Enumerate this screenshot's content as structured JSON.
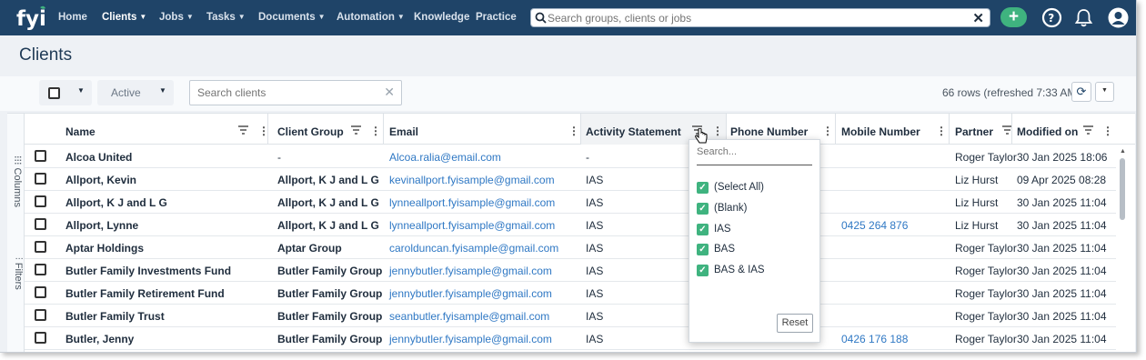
{
  "nav": {
    "items": [
      "Home",
      "Clients",
      "Jobs",
      "Tasks",
      "Documents",
      "Automation",
      "Knowledge",
      "Practice"
    ],
    "search_placeholder": "Search groups, clients or jobs",
    "add_label": "+"
  },
  "page": {
    "title": "Clients"
  },
  "toolbar": {
    "status_filter": "Active",
    "search_placeholder": "Search clients",
    "rows_info": "66 rows  (refreshed 7:33 AM)"
  },
  "side_panel": {
    "columns_label": "Columns",
    "filters_label": "Filters"
  },
  "columns": [
    "Name",
    "Client Group",
    "Email",
    "Activity Statement",
    "Phone Number",
    "Mobile Number",
    "Partner",
    "Modified on"
  ],
  "rows": [
    {
      "name": "Alcoa United",
      "group": "-",
      "email": "Alcoa.ralia@email.com",
      "activity": "-",
      "phone": "",
      "mobile": "",
      "partner": "Roger Taylor",
      "modified": "30 Jan 2025 18:06"
    },
    {
      "name": "Allport, Kevin",
      "group": "Allport, K J and L G",
      "email": "kevinallport.fyisample@gmail.com",
      "activity": "IAS",
      "phone": "",
      "mobile": "",
      "partner": "Liz Hurst",
      "modified": "09 Apr 2025 08:28"
    },
    {
      "name": "Allport, K J and L G",
      "group": "Allport, K J and L G",
      "email": "lynneallport.fyisample@gmail.com",
      "activity": "IAS",
      "phone": "",
      "mobile": "",
      "partner": "Liz Hurst",
      "modified": "30 Jan 2025 11:04"
    },
    {
      "name": "Allport, Lynne",
      "group": "Allport, K J and L G",
      "email": "lynneallport.fyisample@gmail.com",
      "activity": "IAS",
      "phone": "",
      "mobile": "0425 264 876",
      "partner": "Liz Hurst",
      "modified": "30 Jan 2025 11:04"
    },
    {
      "name": "Aptar Holdings",
      "group": "Aptar Group",
      "email": "carolduncan.fyisample@gmail.com",
      "activity": "IAS",
      "phone": "",
      "mobile": "",
      "partner": "Roger Taylor",
      "modified": "30 Jan 2025 11:04"
    },
    {
      "name": "Butler Family Investments Fund",
      "group": "Butler Family Group",
      "email": "jennybutler.fyisample@gmail.com",
      "activity": "IAS",
      "phone": "",
      "mobile": "",
      "partner": "Roger Taylor",
      "modified": "30 Jan 2025 11:04"
    },
    {
      "name": "Butler Family Retirement Fund",
      "group": "Butler Family Group",
      "email": "jennybutler.fyisample@gmail.com",
      "activity": "IAS",
      "phone": "",
      "mobile": "",
      "partner": "Roger Taylor",
      "modified": "30 Jan 2025 11:04"
    },
    {
      "name": "Butler Family Trust",
      "group": "Butler Family Group",
      "email": "seanbutler.fyisample@gmail.com",
      "activity": "IAS",
      "phone": "",
      "mobile": "",
      "partner": "Roger Taylor",
      "modified": "30 Jan 2025 11:04"
    },
    {
      "name": "Butler, Jenny",
      "group": "Butler Family Group",
      "email": "jennybutler.fyisample@gmail.com",
      "activity": "IAS",
      "phone": "",
      "mobile": "0426 176 188",
      "partner": "Roger Taylor",
      "modified": "30 Jan 2025 11:04"
    }
  ],
  "filter_popup": {
    "search_placeholder": "Search...",
    "options": [
      "(Select All)",
      "(Blank)",
      "IAS",
      "BAS",
      "BAS & IAS"
    ],
    "reset_label": "Reset"
  },
  "colors": {
    "nav_bg": "#1f4468",
    "accent_green": "#3fb37f",
    "link": "#2f78c4"
  }
}
